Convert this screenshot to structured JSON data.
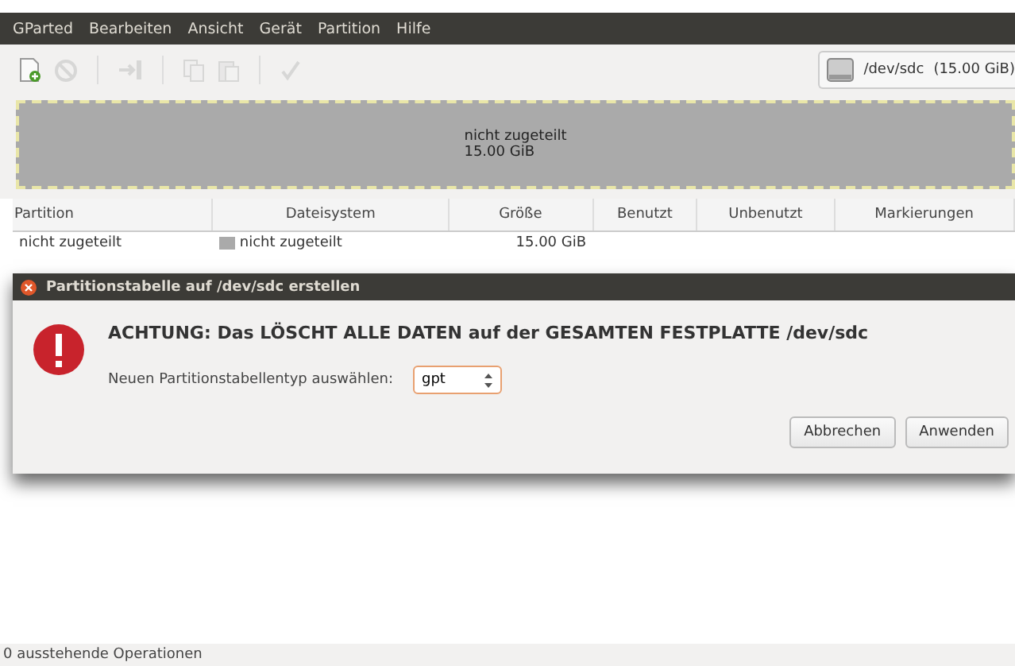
{
  "menubar": [
    "GParted",
    "Bearbeiten",
    "Ansicht",
    "Gerät",
    "Partition",
    "Hilfe"
  ],
  "toolbar": {
    "buttons": [
      {
        "kind": "new",
        "disabled": false
      },
      {
        "kind": "delete",
        "disabled": true
      },
      {
        "kind": "sep"
      },
      {
        "kind": "resize",
        "disabled": true
      },
      {
        "kind": "sep"
      },
      {
        "kind": "copy",
        "disabled": true
      },
      {
        "kind": "paste",
        "disabled": true
      },
      {
        "kind": "sep"
      },
      {
        "kind": "apply",
        "disabled": true
      }
    ]
  },
  "device_selector": {
    "device": "/dev/sdc",
    "size": "(15.00 GiB)"
  },
  "partition_graph": {
    "label": "nicht zugeteilt",
    "size": "15.00 GiB"
  },
  "table": {
    "columns": [
      "Partition",
      "Dateisystem",
      "Größe",
      "Benutzt",
      "Unbenutzt",
      "Markierungen"
    ],
    "rows": [
      {
        "partition": "nicht zugeteilt",
        "filesystem": "nicht zugeteilt",
        "size": "15.00 GiB"
      }
    ]
  },
  "dialog": {
    "title": "Partitionstabelle auf /dev/sdc erstellen",
    "warning": "ACHTUNG:  Das LÖSCHT ALLE DATEN auf der GESAMTEN FESTPLATTE /dev/sdc",
    "field_label": "Neuen Partitionstabellentyp auswählen:",
    "select_value": "gpt",
    "buttons": [
      "Abbrechen",
      "Anwenden"
    ]
  },
  "status_bar": "0 ausstehende Operationen"
}
